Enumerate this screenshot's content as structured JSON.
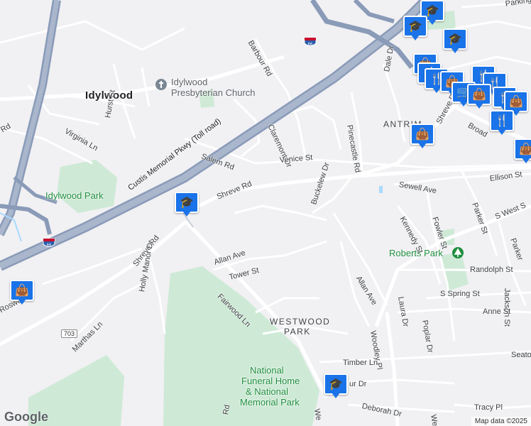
{
  "map": {
    "places": {
      "idylwood": "Idylwood",
      "antrim": "ANTRIM",
      "westwood_1": "WESTWOOD",
      "westwood_2": "PARK"
    },
    "pois": {
      "church_1": "Idylwood",
      "church_2": "Presbyterian Church",
      "idylwood_park": "Idylwood Park",
      "roberts_park": "Roberts Park",
      "funeral_1": "National",
      "funeral_2": "Funeral Home",
      "funeral_3": "& National",
      "funeral_4": "Memorial Park"
    },
    "roads": {
      "barbour": "Barbour Rd",
      "hurst": "Hurst St",
      "virginia": "Virginia Ln",
      "rd_left": "Rd",
      "custis": "Custis Memorial Pkwy (Toll road)",
      "claremont": "Claremont Dr",
      "pinecastle": "Pinecastle Rd",
      "dale": "Dale Dr",
      "salem": "Salem Rd",
      "venice": "Venice St",
      "shreve_main": "Shreve Rd",
      "shreve_ne": "Shreve Rd",
      "shreve_sw": "Shreve Rd",
      "broad": "Broad",
      "parking": "Parking",
      "ellison": "Ellison St",
      "sewell": "Sewell Ave",
      "buckelew": "Buckelew Dr",
      "kennedy": "Kennedy St",
      "fowler": "Fowler St",
      "parker": "Parker St",
      "s_west": "S West S",
      "parker2": "Parker",
      "allan_1": "Allan Ave",
      "allan_2": "Allan Ave",
      "tower": "Tower St",
      "holly_manor": "Holly Manor Dr",
      "fairwood": "Fairwood Ln",
      "randolph": "Randolph St",
      "jackson": "Jackson St",
      "laura": "Laura Dr",
      "s_spring": "S Spring St",
      "poplar": "Poplar Dr",
      "anne": "Anne St",
      "woodley": "Woodley Pl",
      "marthas": "Marthas Ln",
      "timber": "Timber Ln",
      "seaton": "Seato",
      "ur_dr": "ur Dr",
      "deborah": "Deborah Dr",
      "tracy": "Tracy Pl",
      "roswell": "Roswe",
      "we": "We",
      "welc": "Welc",
      "rd_bottom": "Rd"
    },
    "shields": {
      "i66_top": "66",
      "i66_bottom": "66",
      "sr703": "703"
    },
    "icons": {
      "school": "graduation-cap-icon",
      "shopping": "shopping-bag-icon",
      "restaurant": "fork-knife-icon",
      "church": "church-icon",
      "park": "tree-icon"
    },
    "colors": {
      "background": "#f1f0f3",
      "highway": "#8a9bb8",
      "park": "#ceead6",
      "marker": "#1a73e8",
      "water": "#aadaff"
    },
    "logo": "Google",
    "attribution": "Map data ©2025"
  }
}
